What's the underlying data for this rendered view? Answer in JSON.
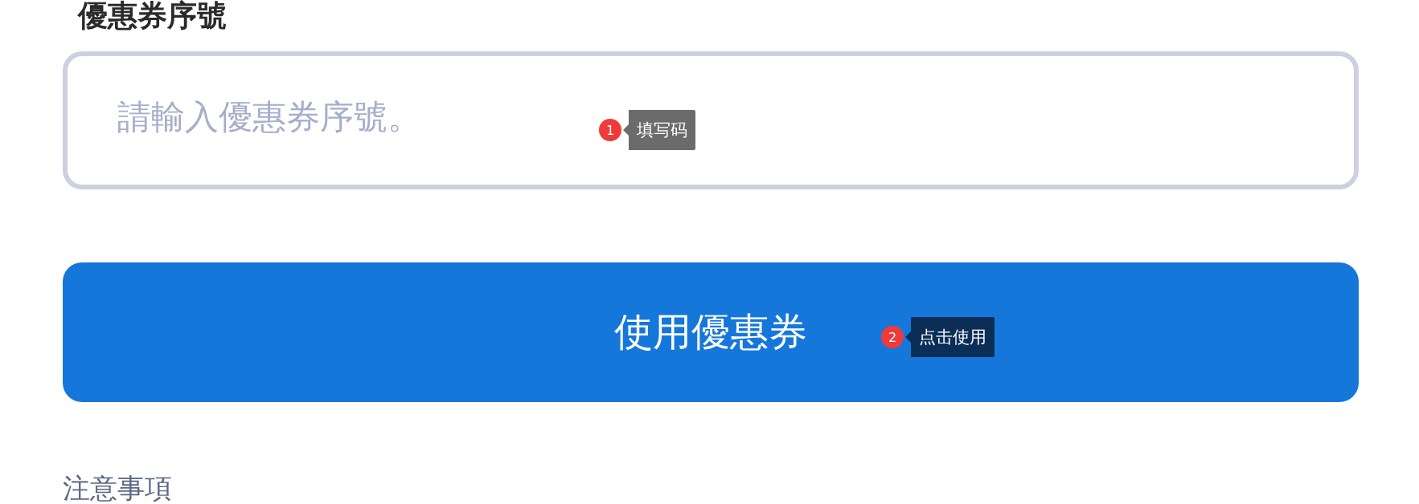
{
  "title": "優惠券序號",
  "coupon_field": {
    "placeholder": "請輸入優惠券序號。"
  },
  "submit_button": {
    "label": "使用優惠券"
  },
  "annotations": [
    {
      "number": "1",
      "label": "填写码",
      "color": "#6b6b6b"
    },
    {
      "number": "2",
      "label": "点击使用",
      "color": "#0b2e57"
    }
  ],
  "notes_heading": "注意事項"
}
